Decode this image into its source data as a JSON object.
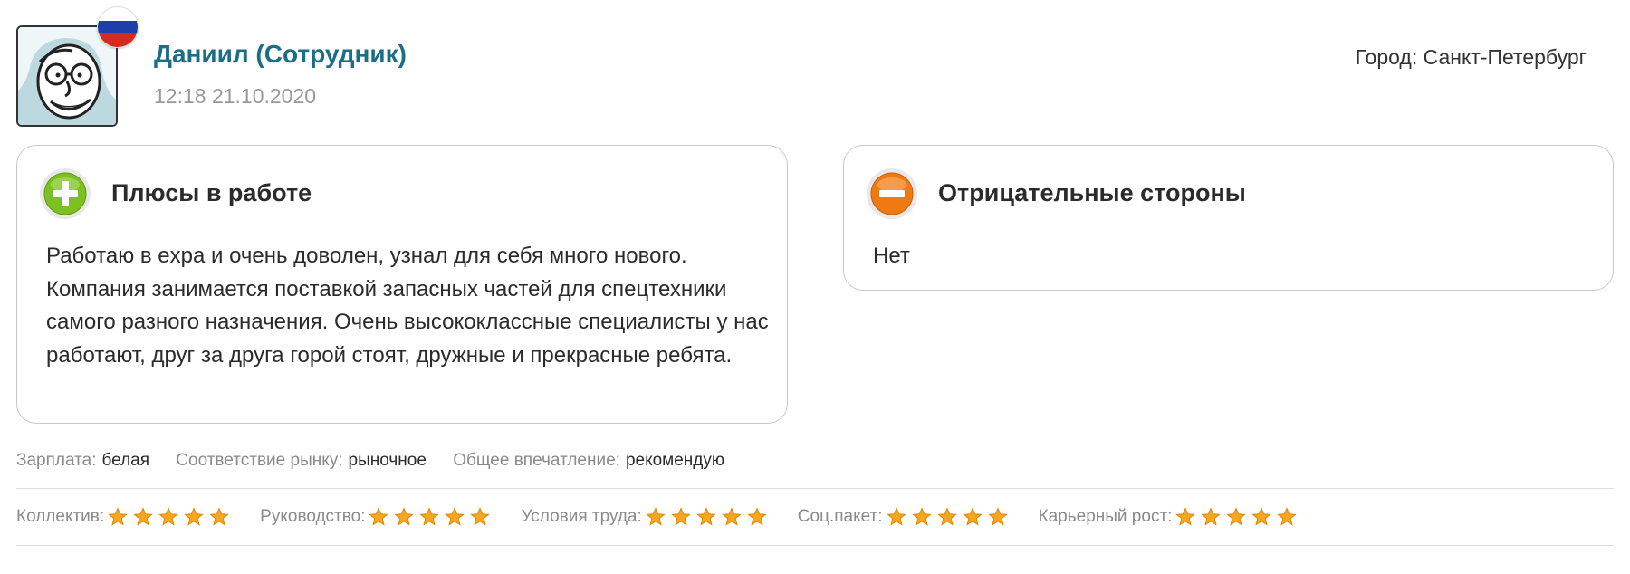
{
  "author": {
    "name": "Даниил (Сотрудник)",
    "date": "12:18 21.10.2020",
    "avatar_icon": "caricature-avatar-icon",
    "flag_icon": "russia-flag-icon",
    "name_color": "#1c6e86"
  },
  "city": {
    "label": "Город:",
    "value": "Санкт-Петербург"
  },
  "pros": {
    "title": "Плюсы в работе",
    "text": "Работаю в expa и очень доволен, узнал для себя много нового. Компания занимается поставкой запасных частей для спецтехники самого разного назначения. Очень высококлассные специалисты у нас работают, друг за друга горой стоят, дружные и прекрасные ребята.",
    "icon": "plus-circle-icon",
    "icon_color": "#7cc11f"
  },
  "cons": {
    "title": "Отрицательные стороны",
    "text": "Нет",
    "icon": "minus-circle-icon",
    "icon_color": "#f07a12"
  },
  "meta": [
    {
      "label": "Зарплата:",
      "value": "белая"
    },
    {
      "label": "Соответствие рынку:",
      "value": "рыночное"
    },
    {
      "label": "Общее впечатление:",
      "value": "рекомендую"
    }
  ],
  "ratings": [
    {
      "label": "Коллектив:",
      "stars": 5,
      "max": 5
    },
    {
      "label": "Руководство:",
      "stars": 5,
      "max": 5
    },
    {
      "label": "Условия труда:",
      "stars": 5,
      "max": 5
    },
    {
      "label": "Соц.пакет:",
      "stars": 5,
      "max": 5
    },
    {
      "label": "Карьерный рост:",
      "stars": 5,
      "max": 5
    }
  ],
  "colors": {
    "star": "#f5a623",
    "star_stroke": "#e08a00"
  }
}
